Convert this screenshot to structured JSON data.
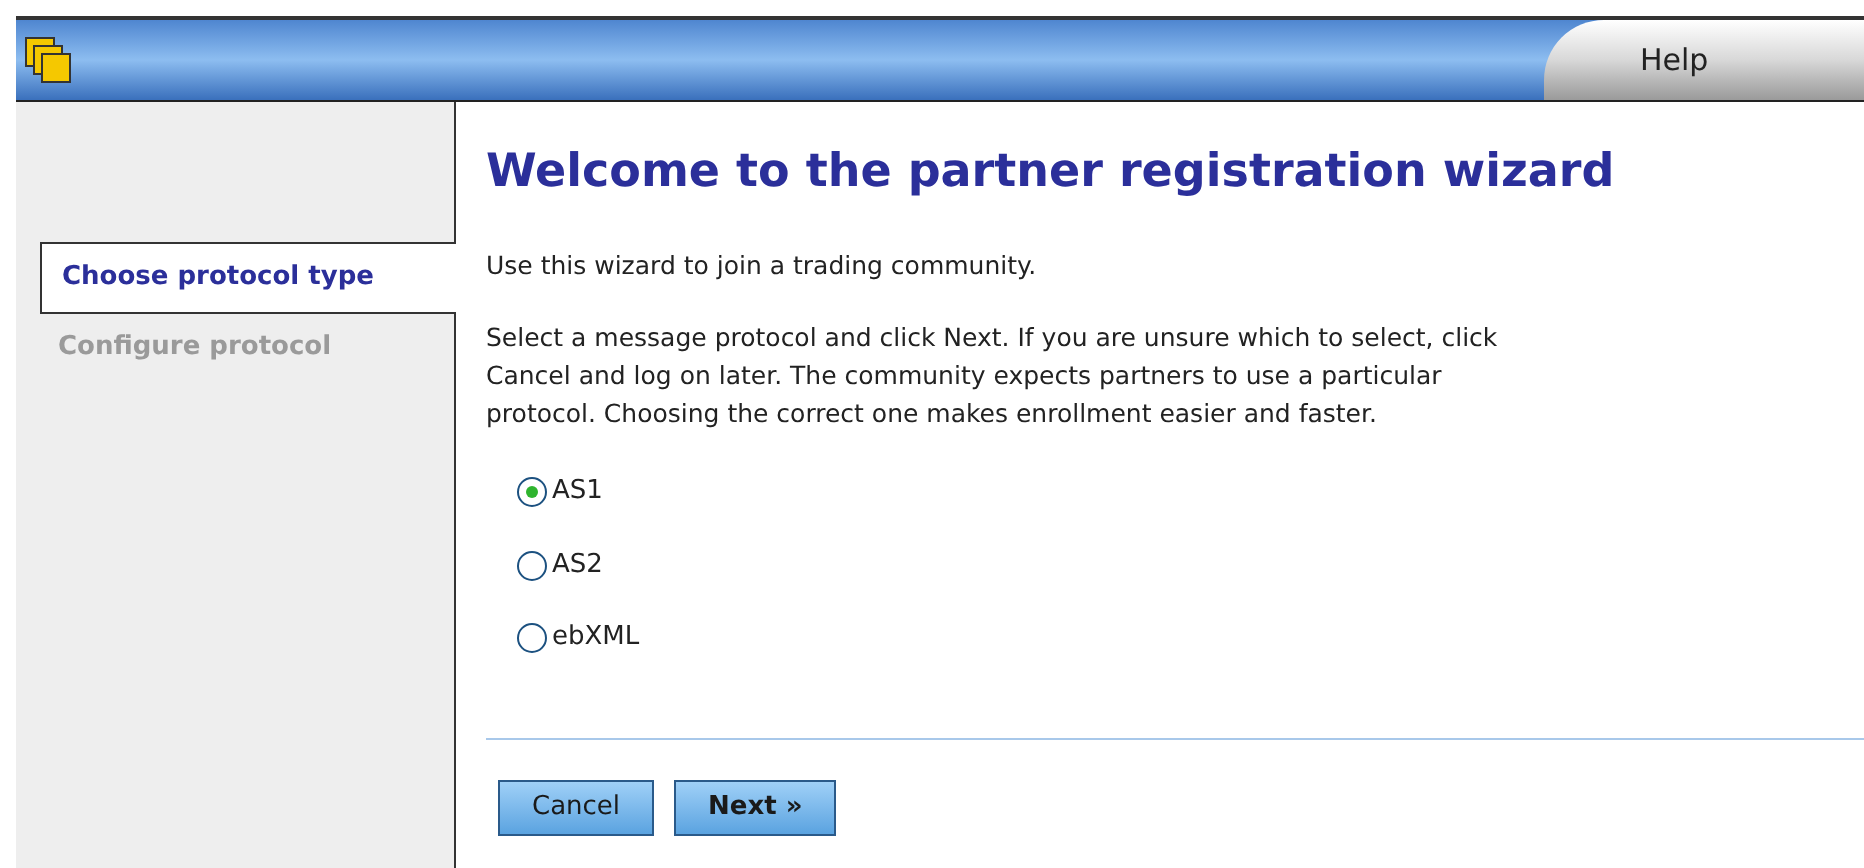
{
  "header": {
    "help_tab": "Help"
  },
  "steps": [
    {
      "label": "Choose protocol type",
      "selected": true
    },
    {
      "label": "Configure protocol",
      "selected": false
    }
  ],
  "title": "Welcome to the partner registration wizard",
  "intro": "Use this wizard to join a trading community.",
  "instructions": [
    "Select a message protocol and click Next. If you are unsure which to select, click",
    "Cancel and log on later. The community expects partners to use a particular",
    "protocol. Choosing the correct one makes enrollment easier and faster."
  ],
  "protocols": [
    {
      "label": "AS1",
      "selected": true
    },
    {
      "label": "AS2",
      "selected": false
    },
    {
      "label": "ebXML",
      "selected": false
    }
  ],
  "buttons": [
    {
      "label": "Cancel",
      "kind": "secondary"
    },
    {
      "label": "Next »",
      "kind": "primary"
    }
  ]
}
